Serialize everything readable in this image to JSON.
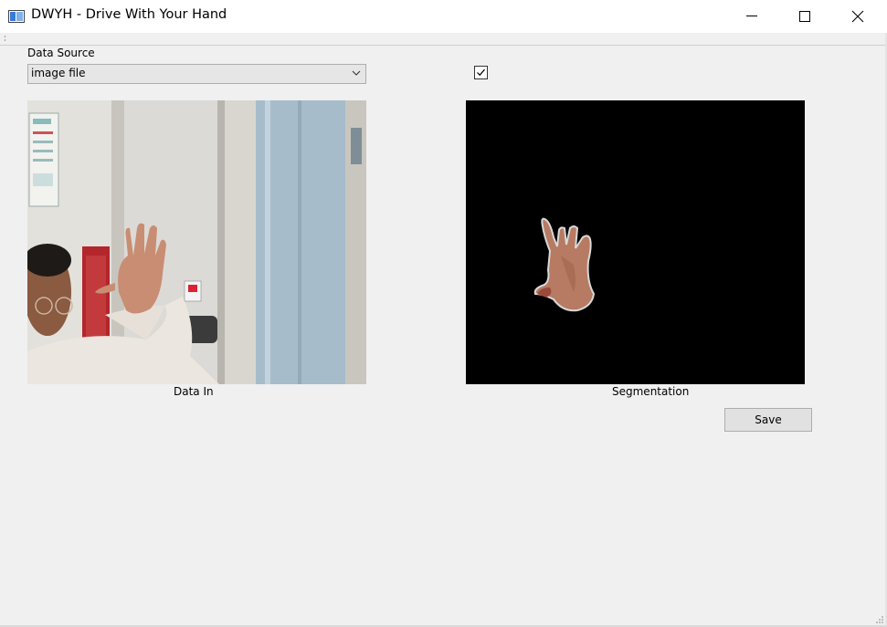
{
  "window": {
    "title": "DWYH - Drive With Your Hand",
    "icons": {
      "app": "app-window-icon",
      "minimize": "minimize-icon",
      "maximize": "maximize-icon",
      "close": "close-icon"
    }
  },
  "controls": {
    "data_source_label": "Data Source",
    "data_source_value": "image file",
    "checkbox_checked": true,
    "save_label": "Save"
  },
  "panels": {
    "input_caption": "Data In",
    "segmentation_caption": "Segmentation"
  },
  "colors": {
    "background": "#f0f0f0",
    "titlebar": "#ffffff",
    "segmentation_background": "#000000"
  }
}
